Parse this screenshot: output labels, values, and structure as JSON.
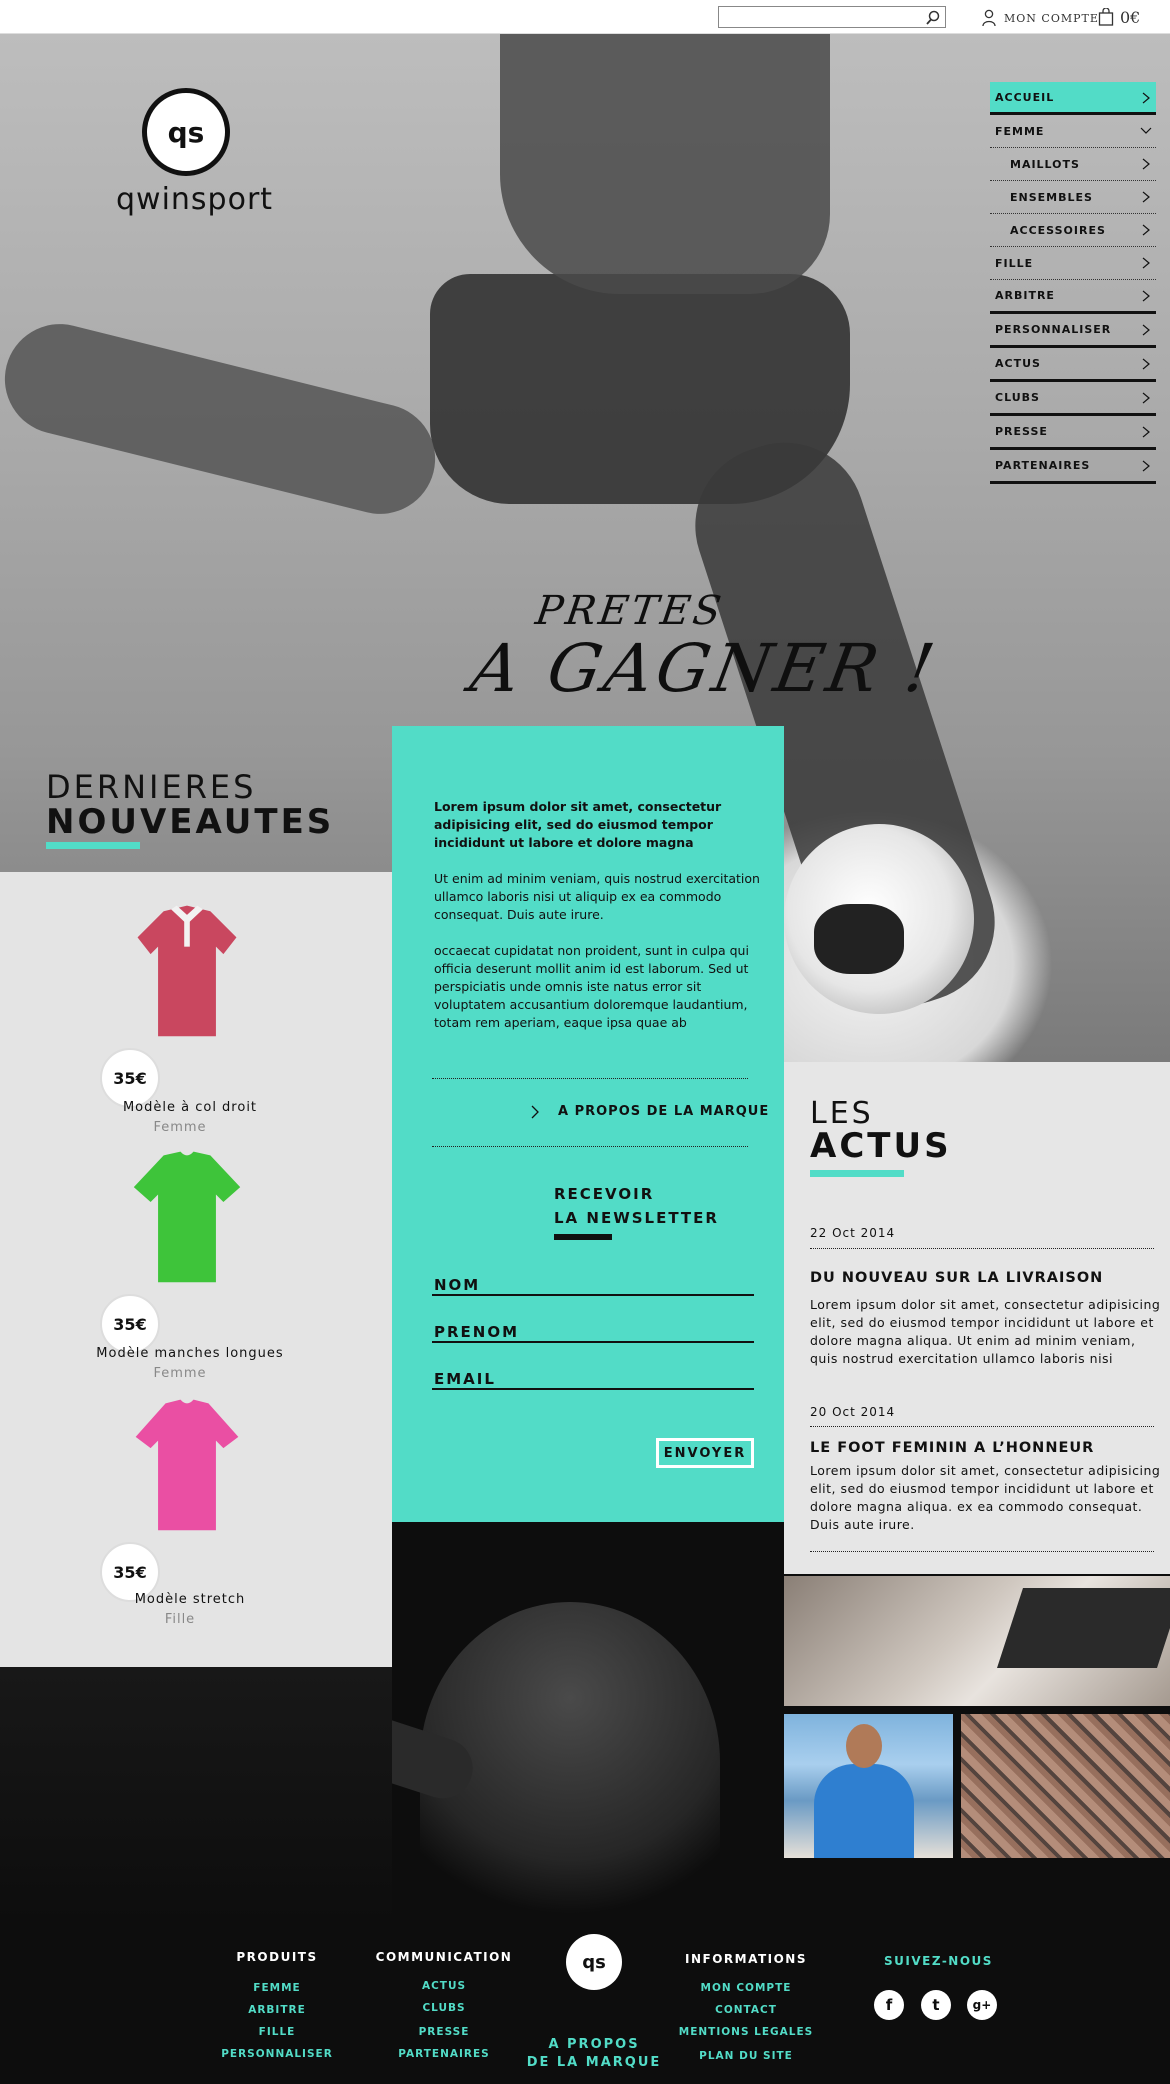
{
  "topbar": {
    "search_placeholder": "",
    "account_label": "MON COMPTE",
    "cart_total": "0€"
  },
  "brand": {
    "badge": "qs",
    "name": "qwinsport"
  },
  "hero": {
    "line1": "PRETES",
    "line2": "A GAGNER !"
  },
  "nav": {
    "items": [
      {
        "label": "ACCUEIL"
      },
      {
        "label": "FEMME"
      },
      {
        "label": "MAILLOTS"
      },
      {
        "label": "ENSEMBLES"
      },
      {
        "label": "ACCESSOIRES"
      },
      {
        "label": "FILLE"
      },
      {
        "label": "ARBITRE"
      },
      {
        "label": "PERSONNALISER"
      },
      {
        "label": "ACTUS"
      },
      {
        "label": "CLUBS"
      },
      {
        "label": "PRESSE"
      },
      {
        "label": "PARTENAIRES"
      }
    ]
  },
  "new_products": {
    "title_light": "DERNIERES",
    "title_bold": "NOUVEAUTES",
    "items": [
      {
        "name": "Modèle à col droit",
        "category": "Femme",
        "price": "35€",
        "color": "#c9475f"
      },
      {
        "name": "Modèle manches longues",
        "category": "Femme",
        "price": "35€",
        "color": "#3ec43a"
      },
      {
        "name": "Modèle stretch",
        "category": "Fille",
        "price": "35€",
        "color": "#ea4fa3"
      }
    ]
  },
  "brand_panel": {
    "lead": "Lorem ipsum dolor sit amet, consectetur adipisicing elit, sed do eiusmod tempor incididunt ut labore et dolore magna",
    "p1": "Ut enim ad minim veniam, quis nostrud exercitation ullamco laboris nisi ut aliquip ex ea commodo consequat. Duis aute irure.",
    "p2": "occaecat cupidatat non proident, sunt in culpa qui officia deserunt mollit anim id est laborum. Sed ut perspiciatis unde omnis iste natus error sit voluptatem accusantium doloremque laudantium, totam rem aperiam, eaque ipsa quae ab",
    "about_link": "A PROPOS DE LA MARQUE",
    "newsletter_line1": "RECEVOIR",
    "newsletter_line2": "LA NEWSLETTER",
    "field_nom": "NOM",
    "field_prenom": "PRENOM",
    "field_email": "EMAIL",
    "send_label": "ENVOYER"
  },
  "news": {
    "title_light": "LES",
    "title_bold": "ACTUS",
    "items": [
      {
        "date": "22 Oct 2014",
        "title": "DU NOUVEAU SUR LA LIVRAISON",
        "body": "Lorem ipsum dolor sit amet, consectetur adipisicing elit, sed do eiusmod tempor incididunt ut labore et dolore magna aliqua. Ut enim ad minim veniam, quis nostrud exercitation ullamco laboris nisi"
      },
      {
        "date": "20 Oct 2014",
        "title": "LE FOOT FEMININ A L’HONNEUR",
        "body": "Lorem ipsum dolor sit amet, consectetur adipisicing elit, sed do eiusmod tempor incididunt ut labore et dolore magna aliqua.  ex ea commodo consequat. Duis aute irure."
      }
    ]
  },
  "footer": {
    "produits": {
      "title": "PRODUITS",
      "links": [
        "FEMME",
        "ARBITRE",
        "FILLE",
        "PERSONNALISER"
      ]
    },
    "communication": {
      "title": "COMMUNICATION",
      "links": [
        "ACTUS",
        "CLUBS",
        "PRESSE",
        "PARTENAIRES"
      ]
    },
    "informations": {
      "title": "INFORMATIONS",
      "links": [
        "MON COMPTE",
        "CONTACT",
        "MENTIONS LEGALES",
        "PLAN DU SITE"
      ]
    },
    "logo": "qs",
    "about_line1": "A PROPOS",
    "about_line2": "DE LA MARQUE",
    "follow": "SUIVEZ-NOUS",
    "social": [
      {
        "name": "facebook",
        "glyph": "f"
      },
      {
        "name": "twitter",
        "glyph": "t"
      },
      {
        "name": "google-plus",
        "glyph": "g+"
      }
    ]
  },
  "colors": {
    "accent": "#52dcc7",
    "dark": "#0d0d0d",
    "panel": "#e4e4e4"
  }
}
